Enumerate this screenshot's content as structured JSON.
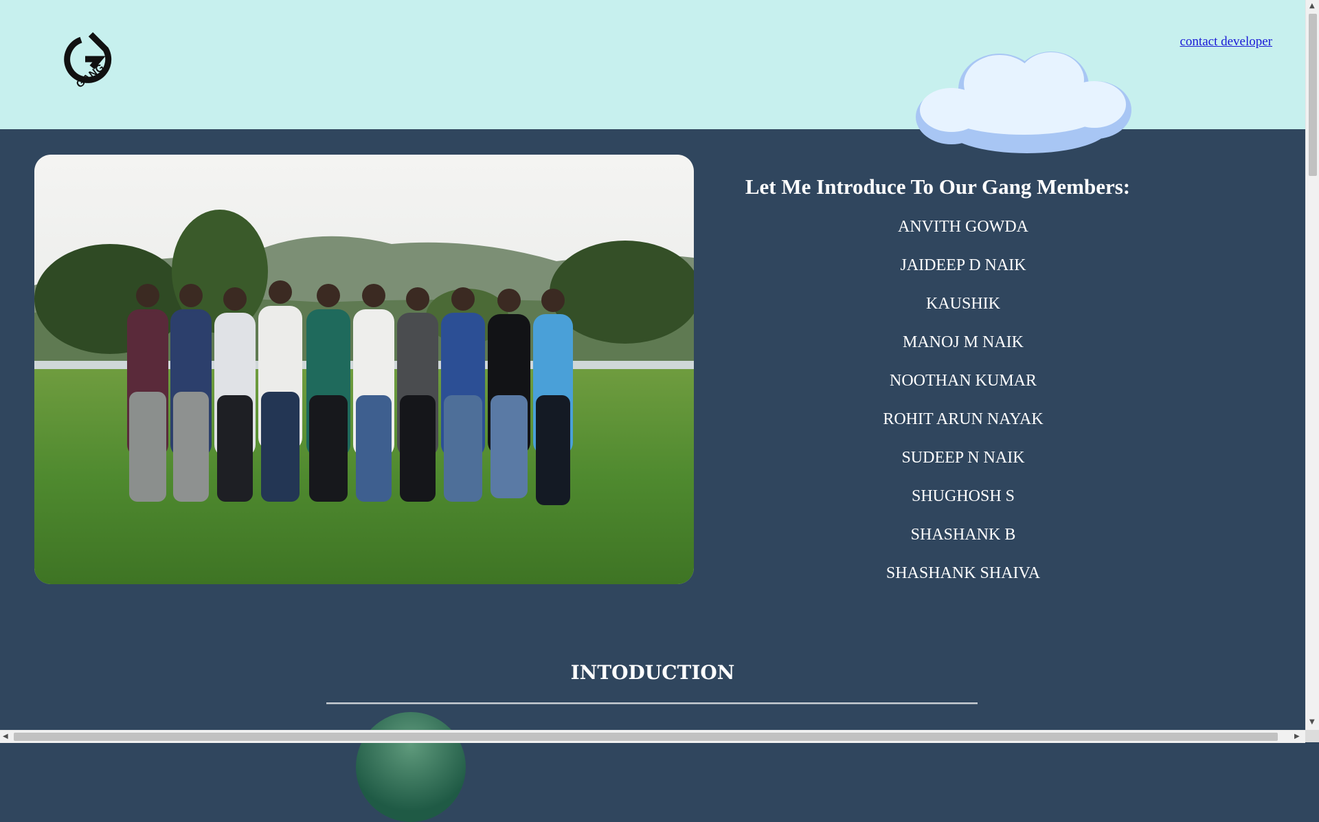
{
  "header": {
    "logo_text": "GANG",
    "contact_link": "contact developer",
    "background": "#c7f0ee"
  },
  "intro": {
    "heading": "Let Me Introduce To Our Gang Members:",
    "members": [
      "ANVITH GOWDA",
      "JAIDEEP D NAIK",
      "KAUSHIK",
      "MANOJ M NAIK",
      "NOOTHAN KUMAR",
      "ROHIT ARUN NAYAK",
      "SUDEEP N NAIK",
      "SHUGHOSH S",
      "SHASHANK B",
      "SHASHANK SHAIVA"
    ]
  },
  "section": {
    "title": "INTODUCTION"
  },
  "colors": {
    "page_background": "#30465e",
    "header_background": "#c7f0ee",
    "link": "#1a1ad6",
    "text": "#ffffff"
  },
  "icons": [
    "gang-logo-icon",
    "cloud-icon",
    "scroll-up-arrow-icon",
    "scroll-down-arrow-icon",
    "scroll-left-arrow-icon",
    "scroll-right-arrow-icon"
  ]
}
